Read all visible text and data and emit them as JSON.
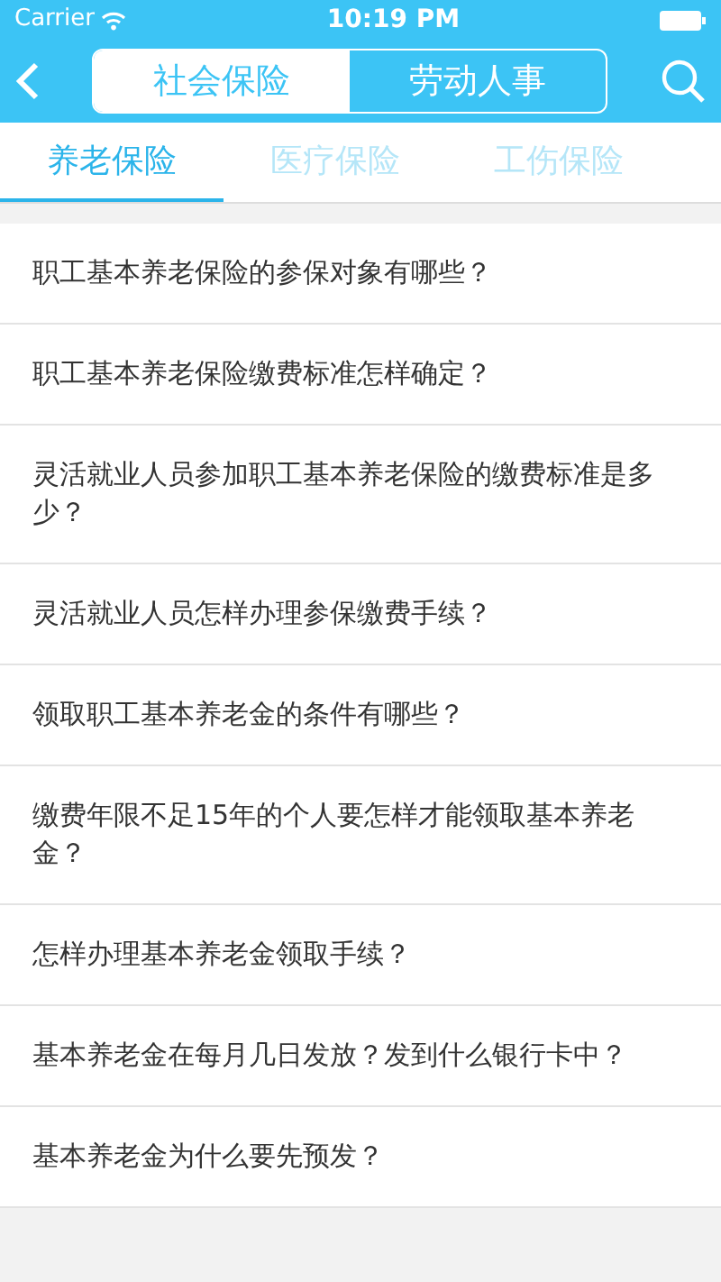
{
  "status_bar": {
    "carrier": "Carrier",
    "time": "10:19 PM"
  },
  "segments": [
    {
      "label": "社会保险",
      "selected": true
    },
    {
      "label": "劳动人事",
      "selected": false
    }
  ],
  "tabs": [
    {
      "label": "养老保险",
      "selected": true
    },
    {
      "label": "医疗保险",
      "selected": false
    },
    {
      "label": "工伤保险",
      "selected": false
    }
  ],
  "questions": [
    "职工基本养老保险的参保对象有哪些？",
    "职工基本养老保险缴费标准怎样确定？",
    "灵活就业人员参加职工基本养老保险的缴费标准是多少？",
    "灵活就业人员怎样办理参保缴费手续？",
    "领取职工基本养老金的条件有哪些？",
    "缴费年限不足15年的个人要怎样才能领取基本养老金？",
    "怎样办理基本养老金领取手续？",
    "基本养老金在每月几日发放？发到什么银行卡中？",
    "基本养老金为什么要先预发？"
  ]
}
